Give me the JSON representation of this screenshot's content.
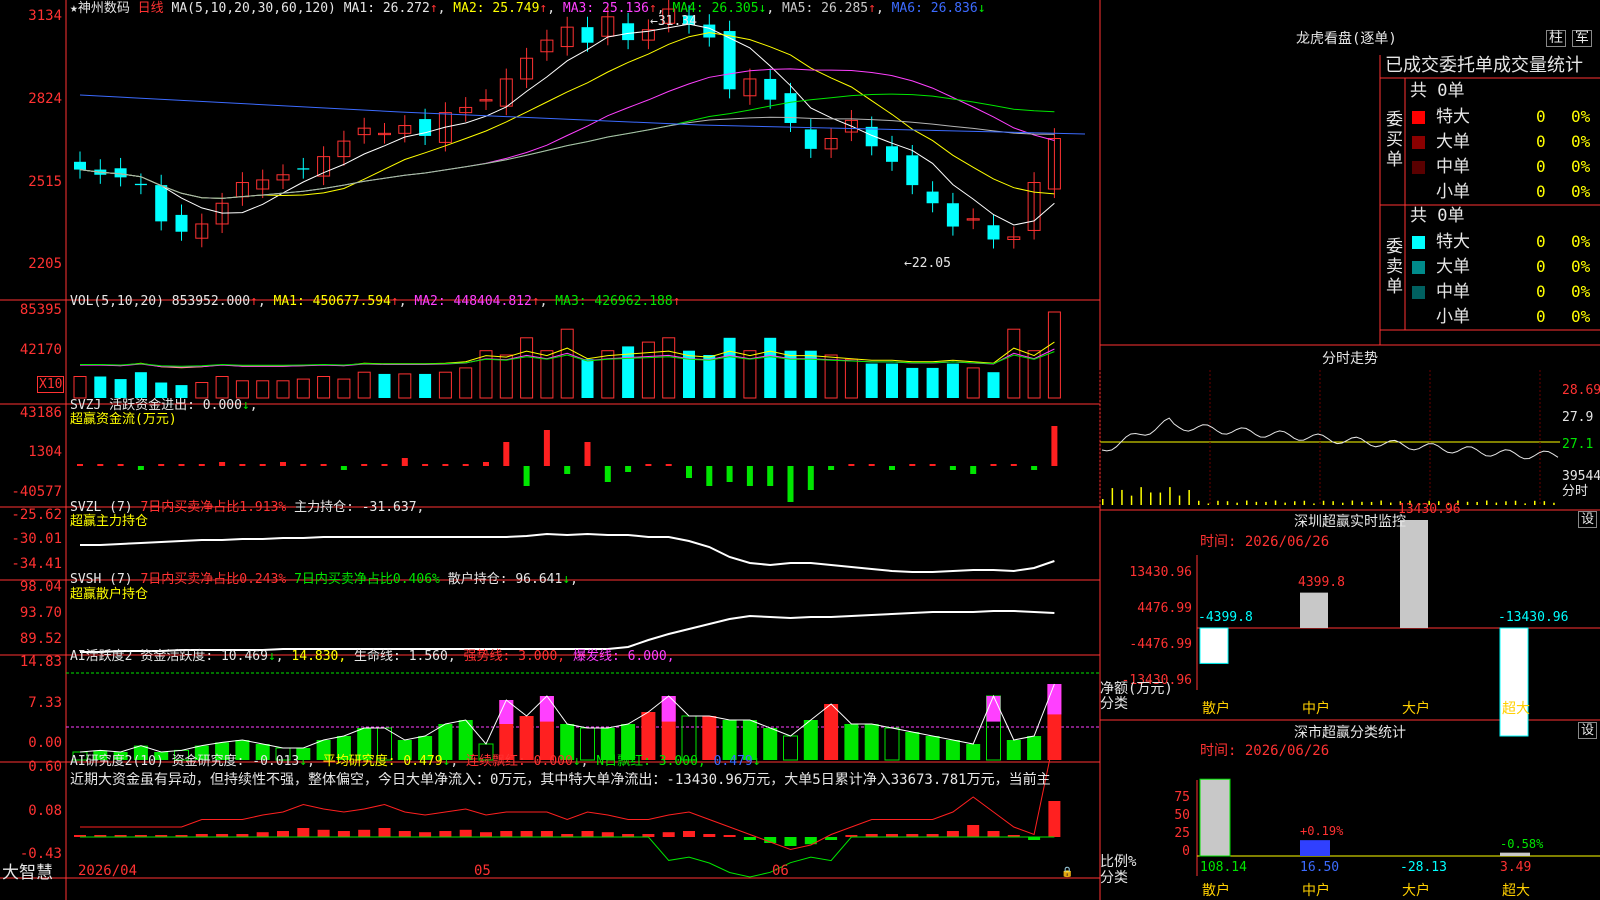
{
  "colors": {
    "up": "#ff3232",
    "down": "#00ffff",
    "bg": "#000000",
    "grid": "#ff3232",
    "ma1": "#ffffff",
    "ma2": "#ffff00",
    "ma3": "#ff40ff",
    "ma4": "#00e600",
    "ma5": "#b4b4b4",
    "ma6": "#3c6bff",
    "buy": "#ff2020",
    "sell": "#00ffff",
    "green": "#00e600"
  },
  "kline": {
    "stock_name": "神州数码",
    "period": "日线",
    "ma_def": "MA(5,10,20,30,60,120)",
    "ma1": "MA1: 26.272",
    "ma2": "MA2: 25.749",
    "ma3": "MA3: 25.136",
    "ma4": "MA4: 26.305",
    "ma5": "MA5: 26.285",
    "ma6": "MA6: 26.836",
    "axis": [
      "3134",
      "2824",
      "2515",
      "2205"
    ],
    "high_label": "31.34",
    "low_label": "22.05"
  },
  "volume": {
    "def": "VOL(5,10,20)",
    "value": "853952.000",
    "ma1": "MA1: 450677.594",
    "ma2": "MA2: 448404.812",
    "ma3": "MA3: 426962.188",
    "axis": [
      "85395",
      "42170"
    ],
    "unit": "X10"
  },
  "svzj": {
    "line1": "SVZJ  活跃资金进出: 0.000",
    "line2": "超赢资金流(万元)",
    "axis": [
      "43186",
      "1304",
      "-40577"
    ]
  },
  "svzl": {
    "line1a": "SVZL (7)",
    "line1b": "7日内买卖净占比1.913%",
    "line1c": "主力持仓: -31.637,",
    "line2": "超赢主力持仓",
    "axis": [
      "-25.62",
      "-30.01",
      "-34.41"
    ]
  },
  "svsh": {
    "line1a": "SVSH (7)",
    "line1b": "7日内买卖净占比0.243%",
    "line1c": "7日内买卖净占比0.406%",
    "line1d": "散户持仓: 96.641",
    "line2": "超赢散户持仓",
    "axis": [
      "98.04",
      "93.70",
      "89.52"
    ]
  },
  "ai_active": {
    "a": "AI活跃度2",
    "b": "资金活跃度: 10.469",
    "c": "14.830,",
    "d": "生命线: 1.560,",
    "e": "强势线: 3.000,",
    "f": "爆发线: 6.000,",
    "axis": [
      "14.83",
      "7.33",
      "0.00"
    ]
  },
  "ai_research": {
    "a": "AI研究度2(10)",
    "b": "资金研究度: -0.013",
    "c": "平均研究度: 0.479",
    "d": "连续飘红: 0.000",
    "e": "N日飘红: 3.000,",
    "f": "0.479",
    "comment": "近期大资金虽有异动，但持续性不强，整体偏空，今日大单净流入：0万元，其中特大单净流出：-13430.96万元，大单5日累计净入33673.781万元，当前主",
    "axis": [
      "0.60",
      "0.08",
      "-0.43"
    ]
  },
  "bottom": {
    "logo": "大智慧",
    "date_start": "2026/04",
    "m5": "05",
    "m6": "06"
  },
  "dragon": {
    "title": "龙虎看盘(逐单)",
    "btn1": "柱",
    "btn2": "军",
    "header": "已成交委托单成交量统计",
    "buy_label": "委买单",
    "sell_label": "委卖单",
    "buy_total": "共 0单",
    "sell_total": "共 0单",
    "buy_rows": [
      {
        "name": "特大",
        "v": "0",
        "p": "0%"
      },
      {
        "name": "大单",
        "v": "0",
        "p": "0%"
      },
      {
        "name": "中单",
        "v": "0",
        "p": "0%"
      },
      {
        "name": "小单",
        "v": "0",
        "p": "0%"
      }
    ],
    "sell_rows": [
      {
        "name": "特大",
        "v": "0",
        "p": "0%"
      },
      {
        "name": "大单",
        "v": "0",
        "p": "0%"
      },
      {
        "name": "中单",
        "v": "0",
        "p": "0%"
      },
      {
        "name": "小单",
        "v": "0",
        "p": "0%"
      }
    ]
  },
  "intraday": {
    "title": "分时走势",
    "prices": [
      "28.69",
      "27.9",
      "27.1"
    ],
    "vol": "39544",
    "vol_unit": "分时"
  },
  "monitor": {
    "title": "深圳超赢实时监控",
    "setting": "设",
    "time": "时间: 2026/06/26",
    "axis": [
      "13430.96",
      "4476.99",
      "-4476.99",
      "-13430.96"
    ],
    "y_title": "净额(万元)",
    "x_title": "分类",
    "bars": [
      {
        "name": "散户",
        "value": -4399.8,
        "label": "-4399.8"
      },
      {
        "name": "中户",
        "value": 4399.8,
        "label": "4399.8"
      },
      {
        "name": "大户",
        "value": 13430.96,
        "label": "13430.96"
      },
      {
        "name": "超大",
        "value": -13430.96,
        "label": "-13430.96"
      }
    ]
  },
  "category": {
    "title": "深市超赢分类统计",
    "setting": "设",
    "time": "时间: 2026/06/26",
    "axis": [
      "75",
      "50",
      "25",
      "0"
    ],
    "y_title": "比例%",
    "x_title": "分类",
    "bars": [
      {
        "name": "散户",
        "value": 108.14,
        "label": "108.14",
        "pct": ""
      },
      {
        "name": "中户",
        "value": 16.5,
        "label": "16.50",
        "pct": "+0.19%"
      },
      {
        "name": "大户",
        "value": -28.13,
        "label": "-28.13",
        "pct": ""
      },
      {
        "name": "超大",
        "value": 3.49,
        "label": "3.49",
        "pct": "-0.58%"
      }
    ]
  }
}
